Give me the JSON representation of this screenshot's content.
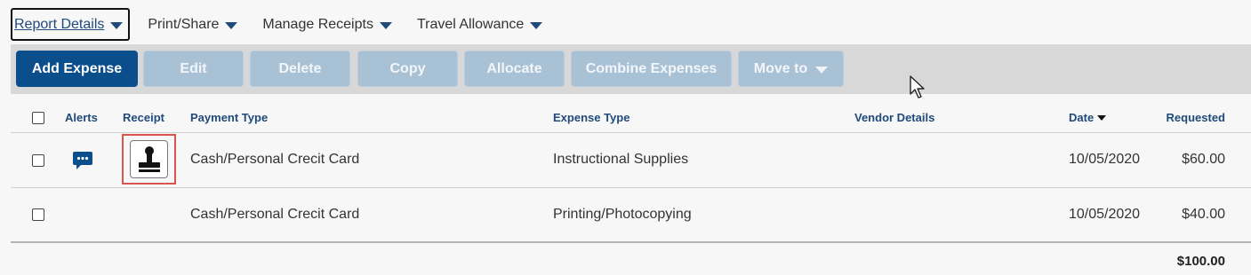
{
  "menu": [
    {
      "label": "Report Details",
      "active": true
    },
    {
      "label": "Print/Share",
      "active": false
    },
    {
      "label": "Manage Receipts",
      "active": false
    },
    {
      "label": "Travel Allowance",
      "active": false
    }
  ],
  "toolbar": {
    "add_expense": "Add Expense",
    "edit": "Edit",
    "delete": "Delete",
    "copy": "Copy",
    "allocate": "Allocate",
    "combine": "Combine Expenses",
    "move_to": "Move to"
  },
  "table": {
    "columns": {
      "alerts": "Alerts",
      "receipt": "Receipt",
      "payment_type": "Payment Type",
      "expense_type": "Expense Type",
      "vendor": "Vendor Details",
      "date": "Date",
      "requested": "Requested"
    },
    "sort_column": "Date",
    "rows": [
      {
        "has_alert": true,
        "has_receipt": true,
        "payment_type": "Cash/Personal Crecit Card",
        "expense_type": "Instructional Supplies",
        "vendor": "",
        "date": "10/05/2020",
        "requested": "$60.00"
      },
      {
        "has_alert": false,
        "has_receipt": false,
        "payment_type": "Cash/Personal Crecit Card",
        "expense_type": "Printing/Photocopying",
        "vendor": "",
        "date": "10/05/2020",
        "requested": "$40.00"
      }
    ],
    "total": "$100.00"
  },
  "colors": {
    "primary": "#0b4e8c",
    "disabled": "#a9c1d5",
    "header_text": "#1f4a7a",
    "receipt_highlight": "#d9534f"
  },
  "icons": {
    "alert": "comment-bubble-icon",
    "receipt": "stamp-icon",
    "sort": "caret-down-icon",
    "cursor": "mouse-pointer-icon"
  }
}
